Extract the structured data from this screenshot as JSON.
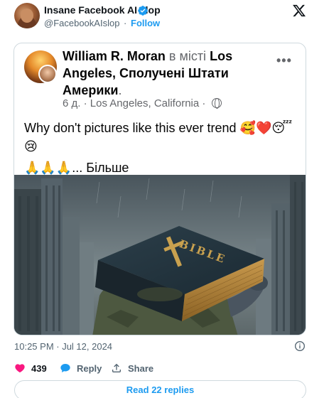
{
  "author": {
    "display_name": "Insane Facebook AI slop",
    "handle": "@FacebookAIslop",
    "separator": "·",
    "follow_label": "Follow"
  },
  "quoted_post": {
    "poster_name": "William R. Moran",
    "in_city_text": "в місті",
    "location_name": "Los Angeles, Сполучені Штати Америки",
    "location_end": ".",
    "age": "6 д.",
    "meta_separator": "·",
    "place": "Los Angeles, California",
    "text_line1": "Why don't pictures like this ever trend 🥰❤️😴",
    "text_line1b": "😢",
    "text_line2_emoji": "🙏🙏🙏",
    "text_line2_more": "... Більше",
    "image_book_title": "BIBLE"
  },
  "tweet": {
    "timestamp": "10:25 PM · Jul 12, 2024"
  },
  "actions": {
    "like_count": "439",
    "reply_label": "Reply",
    "share_label": "Share"
  },
  "replies_button_label": "Read 22 replies",
  "colors": {
    "link_blue": "#1d9bf0",
    "like_pink": "#f91880",
    "text_dark": "#0f1419",
    "text_gray": "#536471"
  }
}
